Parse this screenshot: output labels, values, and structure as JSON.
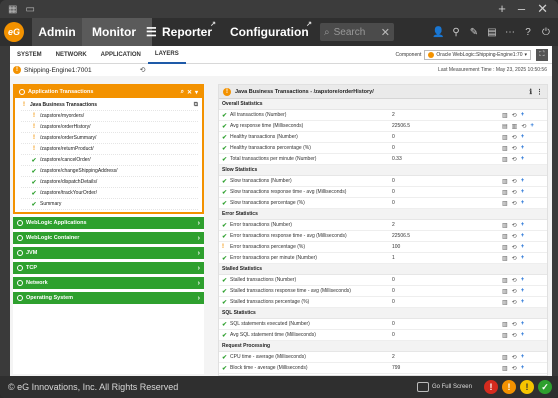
{
  "window": {
    "title_icons": [
      "grid-icon",
      "sidebar-icon"
    ],
    "right_icons": [
      "+",
      "–",
      "✕"
    ]
  },
  "nav": {
    "logo": "eG",
    "admin": "Admin",
    "monitor": "Monitor",
    "reporter": "Reporter",
    "configuration": "Configuration",
    "search_placeholder": "Search"
  },
  "subtabs": [
    "SYSTEM",
    "NETWORK",
    "APPLICATION",
    "LAYERS"
  ],
  "component": {
    "label": "Component",
    "value": "Oracle WebLogic:Shipping-Engine1:70"
  },
  "host": {
    "name": "Shipping-Engine1:7001",
    "measurement_time": "Last Measurement Time : May 23, 2025 10:50:56"
  },
  "left": {
    "app_header": "Application Transactions",
    "tree": [
      {
        "label": "Java Business Transactions",
        "level": 0,
        "status": "warn"
      },
      {
        "label": "/zapstore/myorders/",
        "level": 1,
        "status": "warn"
      },
      {
        "label": "/zapstore/orderHistory/",
        "level": 1,
        "status": "warn"
      },
      {
        "label": "/zapstore/orderSummary/",
        "level": 1,
        "status": "warn"
      },
      {
        "label": "/zapstore/returnProduct/",
        "level": 1,
        "status": "warn"
      },
      {
        "label": "/zapstore/cancelOrder/",
        "level": 1,
        "status": "ok"
      },
      {
        "label": "/zapstore/changeShippingAddress/",
        "level": 1,
        "status": "ok"
      },
      {
        "label": "/zapstore/dispatchDetails/",
        "level": 1,
        "status": "ok"
      },
      {
        "label": "/zapstore/trackYourOrder/",
        "level": 1,
        "status": "ok"
      },
      {
        "label": "Summary",
        "level": 1,
        "status": "ok"
      }
    ],
    "categories": [
      "WebLogic Applications",
      "WebLogic Container",
      "JVM",
      "TCP",
      "Network",
      "Operating System"
    ]
  },
  "right": {
    "title": "Java Business Transactions - /zapstore/orderHistory/",
    "sections": [
      {
        "name": "Overall Statistics",
        "rows": [
          {
            "name": "All transactions (Number)",
            "value": "2",
            "status": "ok",
            "icons": 3
          },
          {
            "name": "Avg response time (Milliseconds)",
            "value": "22506.5",
            "status": "ok",
            "icons": 4
          },
          {
            "name": "Healthy transactions (Number)",
            "value": "0",
            "status": "ok",
            "icons": 3
          },
          {
            "name": "Healthy transactions percentage (%)",
            "value": "0",
            "status": "ok",
            "icons": 3
          },
          {
            "name": "Total transactions per minute (Number)",
            "value": "0.33",
            "status": "ok",
            "icons": 3
          }
        ]
      },
      {
        "name": "Slow Statistics",
        "rows": [
          {
            "name": "Slow transactions (Number)",
            "value": "0",
            "status": "ok",
            "icons": 3
          },
          {
            "name": "Slow transactions response time - avg (Milliseconds)",
            "value": "0",
            "status": "ok",
            "icons": 3
          },
          {
            "name": "Slow transactions percentage (%)",
            "value": "0",
            "status": "ok",
            "icons": 3
          }
        ]
      },
      {
        "name": "Error Statistics",
        "rows": [
          {
            "name": "Error transactions (Number)",
            "value": "2",
            "status": "ok",
            "icons": 3
          },
          {
            "name": "Error transactions response time - avg (Milliseconds)",
            "value": "22506.5",
            "status": "ok",
            "icons": 3
          },
          {
            "name": "Error transactions percentage (%)",
            "value": "100",
            "status": "warn",
            "icons": 3
          },
          {
            "name": "Error transactions per minute (Number)",
            "value": "1",
            "status": "ok",
            "icons": 3
          }
        ]
      },
      {
        "name": "Stalled Statistics",
        "rows": [
          {
            "name": "Stalled transactions (Number)",
            "value": "0",
            "status": "ok",
            "icons": 3
          },
          {
            "name": "Stalled transactions response time - avg (Milliseconds)",
            "value": "0",
            "status": "ok",
            "icons": 3
          },
          {
            "name": "Stalled transactions percentage (%)",
            "value": "0",
            "status": "ok",
            "icons": 3
          }
        ]
      },
      {
        "name": "SQL Statistics",
        "rows": [
          {
            "name": "SQL statements executed (Number)",
            "value": "0",
            "status": "ok",
            "icons": 3
          },
          {
            "name": "Avg SQL statement time (Milliseconds)",
            "value": "0",
            "status": "ok",
            "icons": 3
          }
        ]
      },
      {
        "name": "Request Processing",
        "rows": [
          {
            "name": "CPU time - average (Milliseconds)",
            "value": "2",
            "status": "ok",
            "icons": 3
          },
          {
            "name": "Block time - average (Milliseconds)",
            "value": "799",
            "status": "ok",
            "icons": 3
          }
        ]
      }
    ]
  },
  "footer": {
    "copyright": "© eG Innovations, Inc. All Rights Reserved",
    "full_screen": "Go Full Screen",
    "alarm_counts": [
      "!",
      "!",
      "!",
      "✓"
    ]
  },
  "colors": {
    "accent": "#f39200",
    "ok": "#2ea02e",
    "critical": "#d52b1e",
    "link": "#1e6fd6"
  }
}
